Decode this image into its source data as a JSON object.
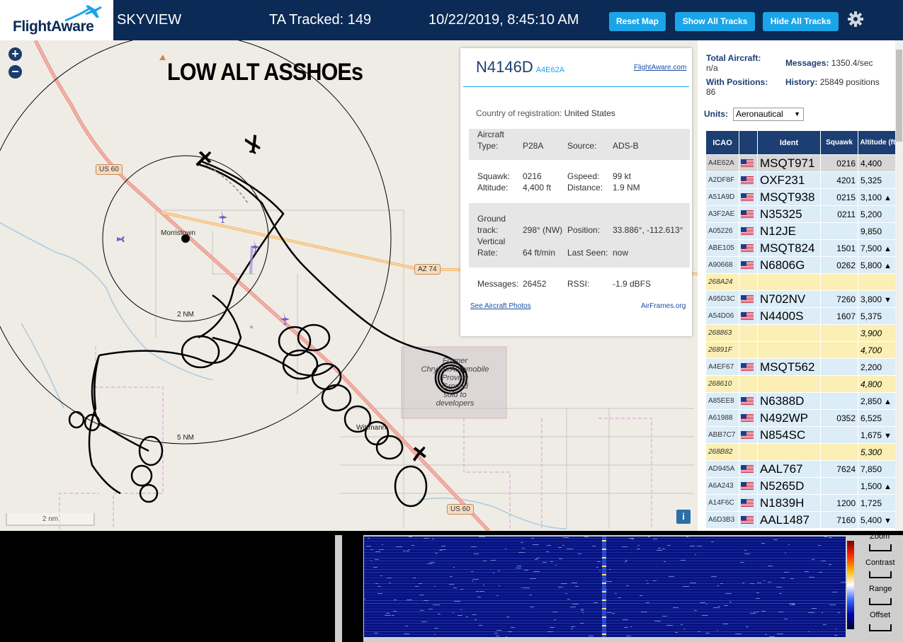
{
  "header": {
    "brand": "FlightAware",
    "app_name": "SKYVIEW",
    "tracked": "TA Tracked: 149",
    "datetime": "10/22/2019, 8:45:10 AM",
    "buttons": [
      "Reset Map",
      "Show All Tracks",
      "Hide All Tracks"
    ],
    "settings_icon": "gear-icon"
  },
  "map": {
    "title": "LOW ALT ASSHOEs",
    "zoom_in": "+",
    "zoom_out": "−",
    "labels": {
      "town1": "Morristown",
      "town2": "Wittmann",
      "ring1": "2 NM",
      "ring2": "5 NM",
      "road1": "US 60",
      "road2": "AZ 74",
      "road3": "US 60",
      "proving_ground": [
        "Former",
        "ChryslerAutomobile",
        "Proving",
        "Ground",
        "sold to",
        "developers"
      ]
    },
    "scale": "2 nm",
    "info_button": "i"
  },
  "popup": {
    "registration": "N4146D",
    "hex": "A4E62A",
    "link_flightaware": "FlightAware.com",
    "country_label": "Country of registration:",
    "country": "United States",
    "aircraft_label": "Aircraft",
    "type_label": "Type:",
    "type": "P28A",
    "source_label": "Source:",
    "source": "ADS-B",
    "squawk_label": "Squawk:",
    "squawk": "0216",
    "gspeed_label": "Gspeed:",
    "gspeed": "99 kt",
    "altitude_label": "Altitude:",
    "altitude": "4,400 ft",
    "distance_label": "Distance:",
    "distance": "1.9 NM",
    "ground_label": "Ground",
    "track_label": "track:",
    "track": "298° (NW)",
    "position_label": "Position:",
    "position": "33.886°, -112.613°",
    "vertical_label": "Vertical",
    "rate_label": "Rate:",
    "rate": "64 ft/min",
    "lastseen_label": "Last Seen:",
    "lastseen": "now",
    "messages_label": "Messages:",
    "messages": "26452",
    "rssi_label": "RSSI:",
    "rssi": "-1.9 dBFS",
    "photos_link": "See Aircraft Photos",
    "airframes_link": "AirFrames.org"
  },
  "stats": {
    "total_label": "Total Aircraft:",
    "total": "n/a",
    "messages_label": "Messages:",
    "messages": "1350.4/sec",
    "positions_label": "With Positions:",
    "positions": "86",
    "history_label": "History:",
    "history": "25849 positions",
    "units_label": "Units:",
    "units": "Aeronautical"
  },
  "table": {
    "headers": [
      "ICAO",
      "Ident",
      "Squawk",
      "Altitude (ft)"
    ],
    "rows": [
      {
        "icao": "A4E62A",
        "flag": true,
        "ident": "MSQT971",
        "squawk": "0216",
        "alt": "4,400",
        "trend": "",
        "style": "selected"
      },
      {
        "icao": "A2DF8F",
        "flag": true,
        "ident": "OXF231",
        "squawk": "4201",
        "alt": "5,325",
        "trend": "",
        "style": "normal"
      },
      {
        "icao": "A51A9D",
        "flag": true,
        "ident": "MSQT938",
        "squawk": "0215",
        "alt": "3,100",
        "trend": "▲",
        "style": "normal"
      },
      {
        "icao": "A3F2AE",
        "flag": true,
        "ident": "N35325",
        "squawk": "0211",
        "alt": "5,200",
        "trend": "",
        "style": "normal"
      },
      {
        "icao": "A05226",
        "flag": true,
        "ident": "N12JE",
        "squawk": "",
        "alt": "9,850",
        "trend": "",
        "style": "normal"
      },
      {
        "icao": "ABE105",
        "flag": true,
        "ident": "MSQT824",
        "squawk": "1501",
        "alt": "7,500",
        "trend": "▲",
        "style": "normal"
      },
      {
        "icao": "A90668",
        "flag": true,
        "ident": "N6806G",
        "squawk": "0262",
        "alt": "5,800",
        "trend": "▲",
        "style": "normal"
      },
      {
        "icao": "268A24",
        "flag": false,
        "ident": "",
        "squawk": "",
        "alt": "",
        "trend": "",
        "style": "mlat"
      },
      {
        "icao": "A95D3C",
        "flag": true,
        "ident": "N702NV",
        "squawk": "7260",
        "alt": "3,800",
        "trend": "▼",
        "style": "normal"
      },
      {
        "icao": "A54D06",
        "flag": true,
        "ident": "N4400S",
        "squawk": "1607",
        "alt": "5,375",
        "trend": "",
        "style": "normal"
      },
      {
        "icao": "268863",
        "flag": false,
        "ident": "",
        "squawk": "",
        "alt": "3,900",
        "trend": "",
        "style": "mlat"
      },
      {
        "icao": "26891F",
        "flag": false,
        "ident": "",
        "squawk": "",
        "alt": "4,700",
        "trend": "",
        "style": "mlat"
      },
      {
        "icao": "A4EF67",
        "flag": true,
        "ident": "MSQT562",
        "squawk": "",
        "alt": "2,200",
        "trend": "",
        "style": "normal"
      },
      {
        "icao": "268610",
        "flag": false,
        "ident": "",
        "squawk": "",
        "alt": "4,800",
        "trend": "",
        "style": "mlat"
      },
      {
        "icao": "A85EE8",
        "flag": true,
        "ident": "N6388D",
        "squawk": "",
        "alt": "2,850",
        "trend": "▲",
        "style": "normal"
      },
      {
        "icao": "A61988",
        "flag": true,
        "ident": "N492WP",
        "squawk": "0352",
        "alt": "6,525",
        "trend": "",
        "style": "normal"
      },
      {
        "icao": "ABB7C7",
        "flag": true,
        "ident": "N854SC",
        "squawk": "",
        "alt": "1,675",
        "trend": "▼",
        "style": "normal"
      },
      {
        "icao": "268B82",
        "flag": false,
        "ident": "",
        "squawk": "",
        "alt": "5,300",
        "trend": "",
        "style": "mlat"
      },
      {
        "icao": "AD945A",
        "flag": true,
        "ident": "AAL767",
        "squawk": "7624",
        "alt": "7,850",
        "trend": "",
        "style": "normal"
      },
      {
        "icao": "A6A243",
        "flag": true,
        "ident": "N5265D",
        "squawk": "",
        "alt": "1,500",
        "trend": "▲",
        "style": "normal"
      },
      {
        "icao": "A14F6C",
        "flag": true,
        "ident": "N1839H",
        "squawk": "1200",
        "alt": "1,725",
        "trend": "",
        "style": "normal"
      },
      {
        "icao": "A6D3B3",
        "flag": true,
        "ident": "AAL1487",
        "squawk": "7160",
        "alt": "5,400",
        "trend": "▼",
        "style": "normal"
      }
    ]
  },
  "waterfall": {
    "zoom": "Zoom",
    "contrast": "Contrast",
    "range": "Range",
    "offset": "Offset"
  },
  "colors": {
    "header_bg": "#0b2a55",
    "button": "#1aa5e8",
    "row_normal": "#dcedf8",
    "row_mlat": "#fbefb5",
    "row_selected": "#d6d6d6"
  }
}
